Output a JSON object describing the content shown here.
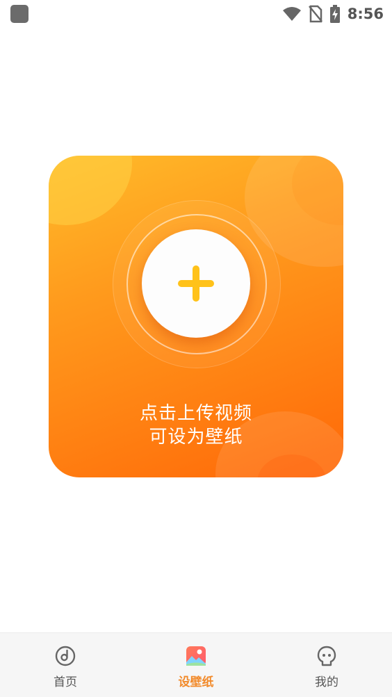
{
  "status_bar": {
    "time": "8:56",
    "icons": [
      "app-icon",
      "wifi-icon",
      "no-sim-icon",
      "battery-charging-icon"
    ]
  },
  "upload": {
    "icon": "plus-icon",
    "line1": "点击上传视频",
    "line2": "可设为壁纸"
  },
  "bottom_nav": {
    "items": [
      {
        "label": "首页",
        "icon": "home-disc-icon",
        "active": false
      },
      {
        "label": "设壁纸",
        "icon": "wallpaper-image-icon",
        "active": true
      },
      {
        "label": "我的",
        "icon": "profile-face-icon",
        "active": false
      }
    ]
  },
  "colors": {
    "card_start": "#ffbb2a",
    "card_end": "#ff6808",
    "plus": "#ffc21a",
    "active_tab": "#f28a2a",
    "inactive_tab": "#555555"
  }
}
